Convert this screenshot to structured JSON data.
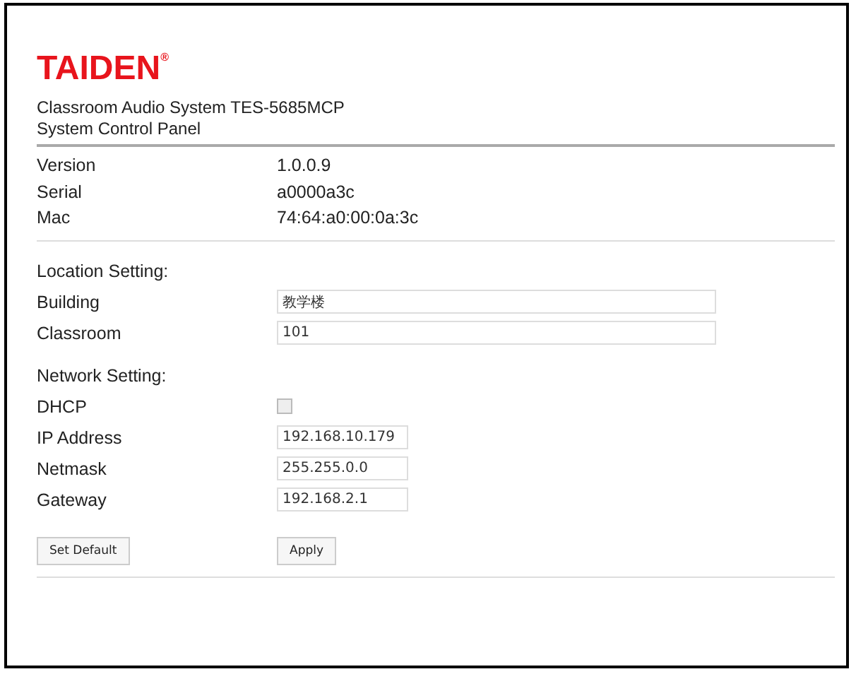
{
  "brand": {
    "logo": "TAIDEN",
    "mark": "®"
  },
  "subtitle": [
    "Classroom Audio System TES-5685MCP",
    "System Control Panel"
  ],
  "info": [
    {
      "label": "Version",
      "value": "1.0.0.9"
    },
    {
      "label": "Serial",
      "value": "a0000a3c"
    },
    {
      "label": "Mac",
      "value": "74:64:a0:00:0a:3c"
    }
  ],
  "sections": [
    {
      "heading": "Location Setting:",
      "fields": [
        {
          "kind": "wide",
          "label": "Building",
          "value": "教学楼"
        },
        {
          "kind": "wide",
          "label": "Classroom",
          "value": "101"
        }
      ]
    },
    {
      "heading": "Network Setting:",
      "fields": [
        {
          "kind": "checkbox",
          "label": "DHCP",
          "checked": false
        },
        {
          "kind": "short",
          "label": "IP Address",
          "value": "192.168.10.179"
        },
        {
          "kind": "short",
          "label": "Netmask",
          "value": "255.255.0.0"
        },
        {
          "kind": "short",
          "label": "Gateway",
          "value": "192.168.2.1"
        }
      ]
    }
  ],
  "buttons": [
    "Set Default",
    "Apply"
  ]
}
